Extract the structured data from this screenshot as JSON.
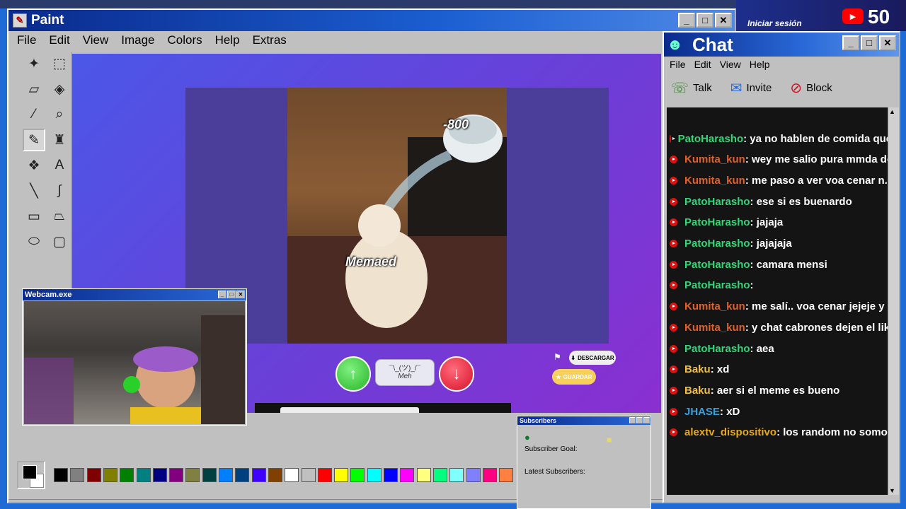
{
  "paint": {
    "title": "Paint",
    "menu": [
      "File",
      "Edit",
      "View",
      "Image",
      "Colors",
      "Help",
      "Extras"
    ],
    "palette_colors": [
      "#000000",
      "#808080",
      "#800000",
      "#808000",
      "#008000",
      "#008080",
      "#000080",
      "#800080",
      "#808040",
      "#004040",
      "#0080ff",
      "#004080",
      "#4000ff",
      "#804000",
      "#ffffff",
      "#c0c0c0",
      "#ff0000",
      "#ffff00",
      "#00ff00",
      "#00ffff",
      "#0000ff",
      "#ff00ff",
      "#ffff80",
      "#00ff80",
      "#80ffff",
      "#8080ff",
      "#ff0080",
      "#ff8040"
    ]
  },
  "meme": {
    "top_text": "-800",
    "bottom_text": "Memaed",
    "meh_label_top": "¯\\_(ツ)_/¯",
    "meh_label": "Meh",
    "descargar_label": "DESCARGAR",
    "guardar_label": "GUARDAR"
  },
  "webcam": {
    "title": "Webcam.exe"
  },
  "subscribers": {
    "title": "Subscribers",
    "goal_label": "Subscriber Goal:",
    "latest_label": "Latest Subscribers:"
  },
  "chat": {
    "title": "Chat",
    "menu": [
      "File",
      "Edit",
      "View",
      "Help"
    ],
    "toolbar": {
      "talk": "Talk",
      "invite": "Invite",
      "block": "Block"
    },
    "messages": [
      {
        "user": "PatoHarasho",
        "text": " : ya no hablen de comida que me",
        "color": "#34d67a"
      },
      {
        "user": "Kumita_kun",
        "text": " : wey me salio pura mmda de in",
        "color": "#e0622a"
      },
      {
        "user": "Kumita_kun",
        "text": " : me paso a ver voa cenar n.n",
        "color": "#e0622a"
      },
      {
        "user": "PatoHarasho",
        "text": " : ese si es buenardo",
        "color": "#34d67a"
      },
      {
        "user": "PatoHarasho",
        "text": " : jajaja",
        "color": "#34d67a"
      },
      {
        "user": "PatoHarasho",
        "text": " : jajajaja",
        "color": "#34d67a"
      },
      {
        "user": "PatoHarasho",
        "text": " : camara mensi",
        "color": "#34d67a"
      },
      {
        "user": "PatoHarasho",
        "text": " : ",
        "color": "#34d67a"
      },
      {
        "user": "Kumita_kun",
        "text": " : me salí.. voa cenar jejeje y sig",
        "color": "#e0622a"
      },
      {
        "user": "Kumita_kun",
        "text": " : y chat cabrones dejen el like",
        "color": "#e0622a"
      },
      {
        "user": "PatoHarasho",
        "text": " : aea",
        "color": "#34d67a"
      },
      {
        "user": "Baku",
        "text": " : xd",
        "color": "#f0c040"
      },
      {
        "user": "Baku",
        "text": " : aer si el meme es bueno",
        "color": "#f0c040"
      },
      {
        "user": "JHASE",
        "text": " : xD",
        "color": "#3aa0d8"
      },
      {
        "user": "alextv_dispositivo",
        "text": " : los random no somos na",
        "color": "#e8a820"
      }
    ]
  },
  "overlay": {
    "login": "Iniciar sesión",
    "count": "50"
  }
}
